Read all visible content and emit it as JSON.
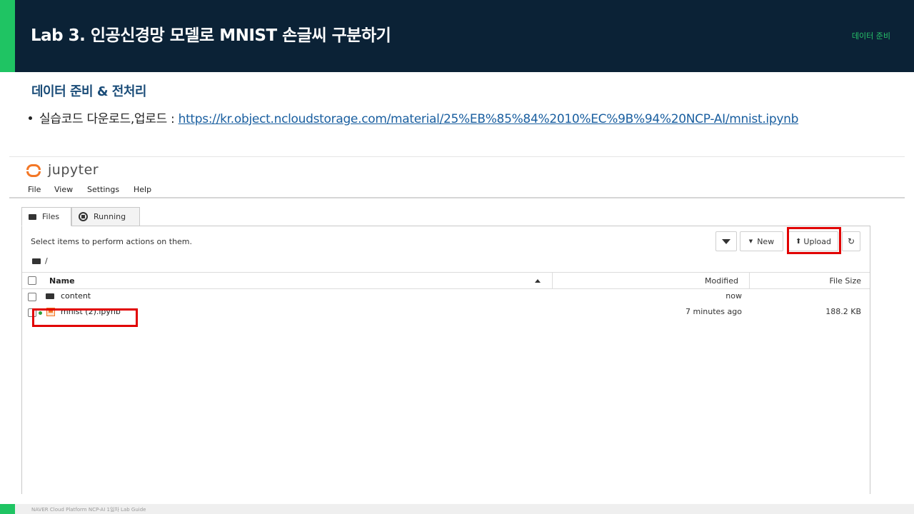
{
  "header": {
    "title": "Lab 3. 인공신경망 모델로 MNIST 손글씨 구분하기",
    "tag": "데이터 준비"
  },
  "section": {
    "title": "데이터 준비 & 전처리",
    "bullet_text": "실습코드 다운로드,업로드 : ",
    "link": "https://kr.object.ncloudstorage.com/material/25%EB%85%84%2010%EC%9B%94%20NCP-AI/mnist.ipynb"
  },
  "jupyter": {
    "brand": "jupyter",
    "menu": [
      "File",
      "View",
      "Settings",
      "Help"
    ],
    "tabs": [
      "Files",
      "Running"
    ],
    "select_message": "Select items to perform actions on them.",
    "breadcrumb": "/",
    "buttons": {
      "new": "New",
      "upload": "Upload",
      "refresh": "↻"
    },
    "columns": {
      "name": "Name",
      "modified": "Modified",
      "size": "File Size"
    },
    "rows": [
      {
        "name": "content",
        "type": "folder",
        "modified": "now",
        "size": ""
      },
      {
        "name": "mnist (2).ipynb",
        "type": "notebook",
        "running": true,
        "modified": "7 minutes ago",
        "size": "188.2 KB"
      }
    ],
    "highlight_color": "#e10000"
  },
  "footer": {
    "text": "NAVER Cloud Platform  NCP-AI 1일차 Lab Guide"
  },
  "colors": {
    "header_bg": "#0b2236",
    "accent_green": "#1fc463",
    "section_title": "#1a4c78",
    "link": "#1a5fa0"
  }
}
